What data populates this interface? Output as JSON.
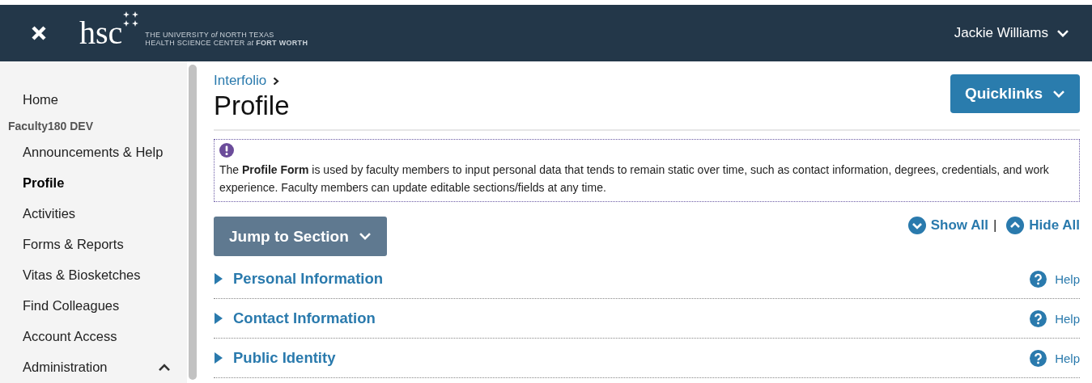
{
  "header": {
    "logo_mark": "hsc",
    "logo_lines": [
      "THE UNIVERSITY *of* NORTH TEXAS",
      "HEALTH SCIENCE CENTER *at* **FORT WORTH**"
    ],
    "user": "Jackie Williams"
  },
  "sidebar": {
    "items": [
      {
        "label": "Home",
        "kind": "link",
        "selected": false
      },
      {
        "label": "Faculty180 DEV",
        "kind": "heading"
      },
      {
        "label": "Announcements & Help",
        "kind": "link",
        "selected": false
      },
      {
        "label": "Profile",
        "kind": "link",
        "selected": true
      },
      {
        "label": "Activities",
        "kind": "link",
        "selected": false
      },
      {
        "label": "Forms & Reports",
        "kind": "link",
        "selected": false
      },
      {
        "label": "Vitas & Biosketches",
        "kind": "link",
        "selected": false
      },
      {
        "label": "Find Colleagues",
        "kind": "link",
        "selected": false
      },
      {
        "label": "Account Access",
        "kind": "link",
        "selected": false
      },
      {
        "label": "Administration",
        "kind": "group",
        "selected": false,
        "expanded": true
      }
    ]
  },
  "breadcrumb": "Interfolio",
  "title": "Profile",
  "quicklinks": "Quicklinks",
  "notice": "The **Profile Form** is used by faculty members to input personal data that tends to remain static over time, such as contact information, degrees, credentials, and work experience. Faculty members can update editable sections/fields at any time.",
  "jump": "Jump to Section",
  "show_all": "Show All",
  "separator": "|",
  "hide_all": "Hide All",
  "sections": [
    {
      "title": "Personal Information",
      "help": "Help",
      "expanded": false
    },
    {
      "title": "Contact Information",
      "help": "Help",
      "expanded": false
    },
    {
      "title": "Public Identity",
      "help": "Help",
      "expanded": false
    }
  ]
}
